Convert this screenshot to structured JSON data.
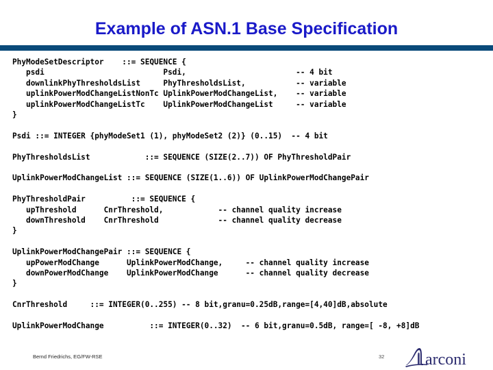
{
  "slide": {
    "title": "Example of ASN.1 Base Specification",
    "title_color": "#1a1ac8",
    "rule_color": "#0a4a7a",
    "background_color": "#ffffff"
  },
  "code": {
    "lines": [
      "PhyModeSetDescriptor    ::= SEQUENCE {",
      "   psdi                          Psdi,                        -- 4 bit",
      "   downlinkPhyThresholdsList     PhyThresholdsList,           -- variable",
      "   uplinkPowerModChangeListNonTc UplinkPowerModChangeList,    -- variable",
      "   uplinkPowerModChangeListTc    UplinkPowerModChangeList     -- variable",
      "}",
      "",
      "Psdi ::= INTEGER {phyModeSet1 (1), phyModeSet2 (2)} (0..15)  -- 4 bit",
      "",
      "PhyThresholdsList            ::= SEQUENCE (SIZE(2..7)) OF PhyThresholdPair",
      "",
      "UplinkPowerModChangeList ::= SEQUENCE (SIZE(1..6)) OF UplinkPowerModChangePair",
      "",
      "PhyThresholdPair          ::= SEQUENCE {",
      "   upThreshold      CnrThreshold,            -- channel quality increase",
      "   downThreshold    CnrThreshold             -- channel quality decrease",
      "}",
      "",
      "UplinkPowerModChangePair ::= SEQUENCE {",
      "   upPowerModChange      UplinkPowerModChange,     -- channel quality increase",
      "   downPowerModChange    UplinkPowerModChange      -- channel quality decrease",
      "}",
      "",
      "CnrThreshold     ::= INTEGER(0..255) -- 8 bit,granu=0.25dB,range=[4,40]dB,absolute",
      "",
      "UplinkPowerModChange          ::= INTEGER(0..32)  -- 6 bit,granu=0.5dB, range=[ -8, +8]dB"
    ]
  },
  "footer": {
    "author": "Bernd Friedrichs, EG/FW-RSE",
    "page_number": "32",
    "logo_text": "Marconi",
    "logo_color": "#2b2b6e"
  }
}
